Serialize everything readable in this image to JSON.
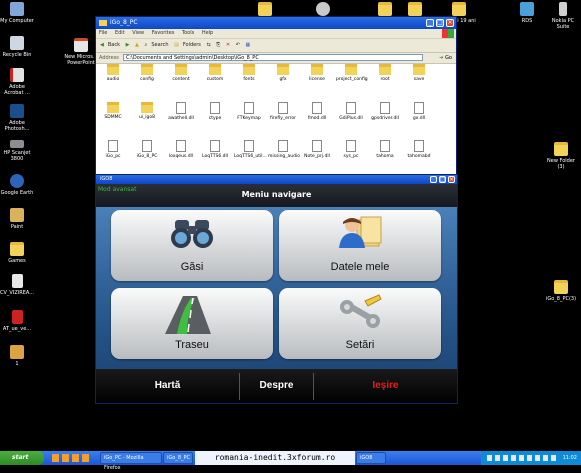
{
  "desktop": {
    "left_icons": [
      "My Computer",
      "Recycle Bin",
      "Adobe Acrobat ...",
      "Adobe Photosh...",
      "HP Scanjet 3800",
      "Google Earth",
      "Paint",
      "Games",
      "CV_VIZIREA...",
      "AT_ue_ve...",
      "1"
    ],
    "other_icons": [
      "New Micros... PowerPoint",
      "zua lui 19 ani",
      "RDS",
      "Nokia PC Suite",
      "New Folder (3)",
      "iGo_8_PC(3)"
    ]
  },
  "explorer": {
    "title": "iGo_8_PC",
    "menu": [
      "File",
      "Edit",
      "View",
      "Favorites",
      "Tools",
      "Help"
    ],
    "toolbar": [
      "Back",
      "Search",
      "Folders"
    ],
    "address_label": "Address",
    "address": "C:\\Documents and Settings\\admin\\Desktop\\iGo_8_PC",
    "go": "Go",
    "files": [
      "audio",
      "config",
      "content",
      "custom",
      "fonts",
      "gfx",
      "license",
      "project_config",
      "root",
      "save",
      "SDMMC",
      "ui_igo8",
      "awathell.dll",
      "ctype",
      "FTKeymap",
      "firefly_error",
      "fmod.dll",
      "GdiPlus.dll",
      "gpsdriver.dll",
      "gx.dll",
      "iGo_pc",
      "iGo_8_PC",
      "loxqeus.dll",
      "LoqTTS6.dll",
      "LoqTTS6_util...",
      "missing_audio",
      "Note_prj.dll",
      "sys_pc",
      "tahoma",
      "tahomabd"
    ]
  },
  "igo": {
    "window_title": "iGO8",
    "mode": "Mod avansat",
    "menu_title": "Meniu navigare",
    "tiles": [
      "Găsi",
      "Datele mele",
      "Traseu",
      "Setări"
    ],
    "footer": {
      "map": "Hartă",
      "about": "Despre",
      "exit": "Ieşire"
    },
    "colors": {
      "exit": "#e02020",
      "panel": "#2a5b91"
    }
  },
  "taskbar": {
    "start": "start",
    "tasks": [
      "iGo_PC - Mozilla Firefox",
      "iGo_8_PC",
      "iGO8"
    ],
    "clock": "11:02"
  },
  "watermark": "romania-inedit.3xforum.ro"
}
